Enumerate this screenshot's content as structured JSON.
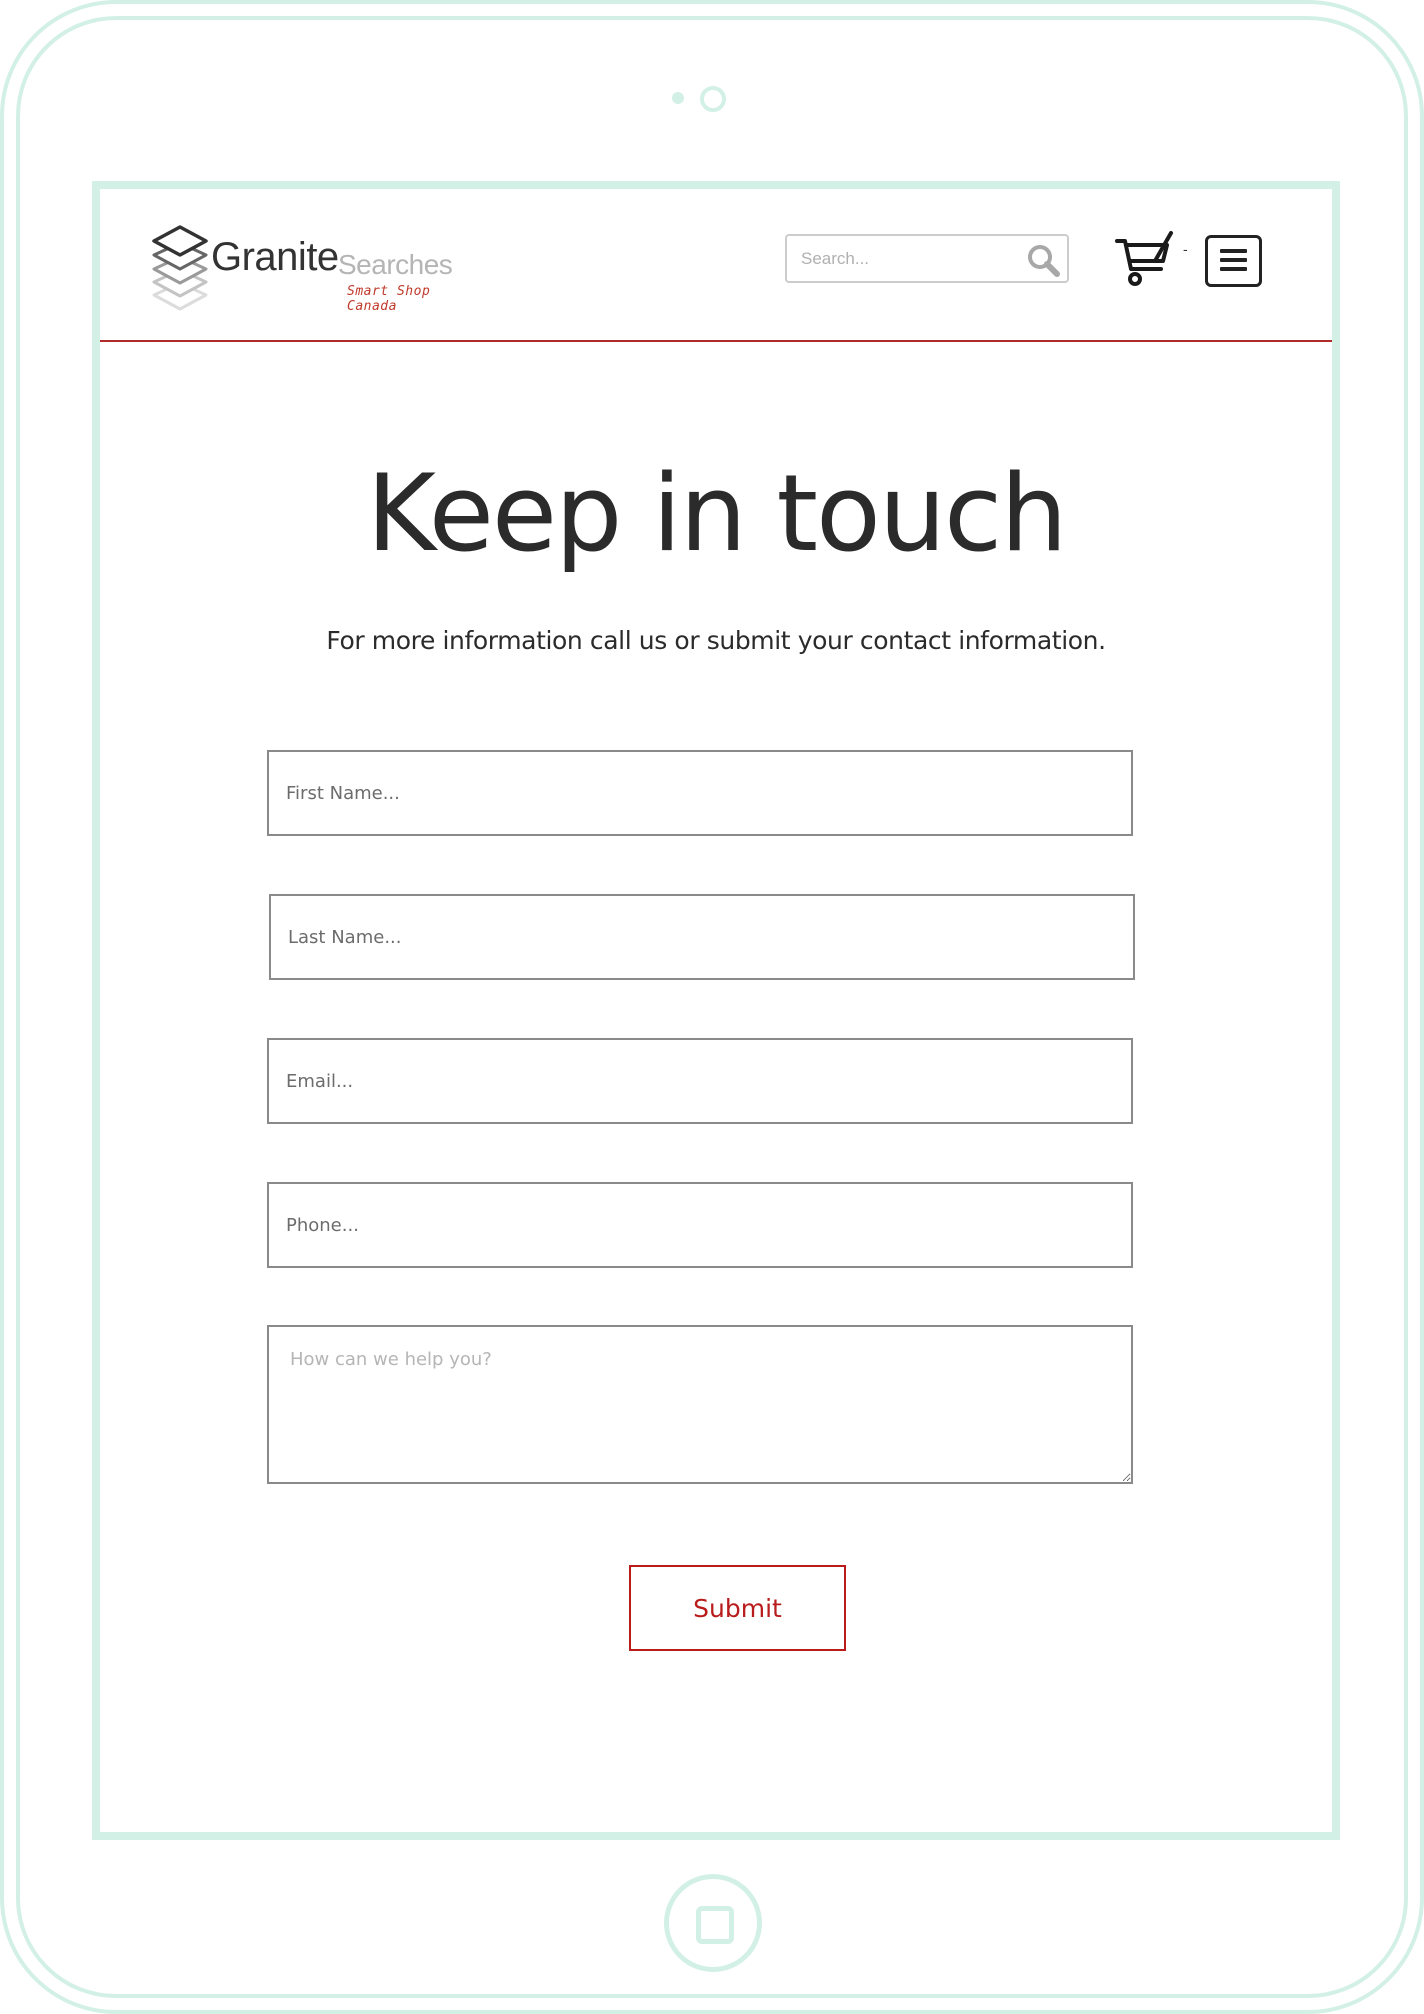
{
  "brand": {
    "name_primary": "Granite",
    "name_secondary": "Searches",
    "tagline": "Smart Shop Canada",
    "accent_color": "#b22b2b",
    "frame_color": "#d3f0e7"
  },
  "header": {
    "search_placeholder": "Search...",
    "search_icon": "search-icon",
    "cart_icon": "cart-icon",
    "cart_count": "-",
    "menu_icon": "hamburger-menu-icon"
  },
  "main": {
    "title": "Keep in touch",
    "subtitle": "For more information call us or submit your contact information."
  },
  "form": {
    "first_name_placeholder": "First Name...",
    "last_name_placeholder": "Last Name...",
    "email_placeholder": "Email...",
    "phone_placeholder": "Phone...",
    "message_placeholder": "How can we help you?",
    "submit_label": "Submit"
  }
}
